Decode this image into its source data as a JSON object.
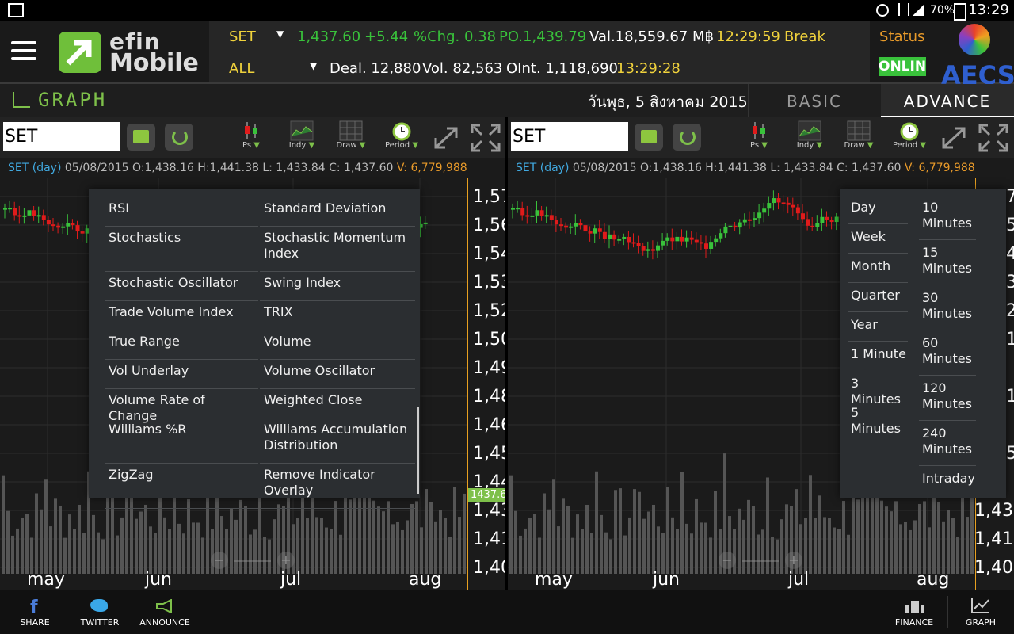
{
  "status_bar": {
    "battery": "70%",
    "time": "13:29"
  },
  "header": {
    "logo_line1": "efin",
    "logo_line2": "Mobile",
    "row1": {
      "symbol": "SET",
      "last": "1,437.60",
      "change": "+5.44",
      "pct_change": "%Chg. 0.38",
      "po": "PO.1,439.79",
      "value": "Val.18,559.67 M฿",
      "time": "12:29:59",
      "session": "Break"
    },
    "row2": {
      "market": "ALL",
      "deal": "Deal. 12,880",
      "volume": "Vol. 82,563",
      "open_interest": "OInt. 1,118,690",
      "time": "13:29:28"
    },
    "status_label": "Status",
    "status_value": "ONLIN",
    "broker": "AECS"
  },
  "graph_bar": {
    "title": "GRAPH",
    "date": "วันพุธ, 5 สิงหาคม 2015",
    "tab_basic": "BASIC",
    "tab_advance": "ADVANCE"
  },
  "toolbar": {
    "symbol_value": "SET",
    "tools": [
      "Ps",
      "Indy",
      "Draw",
      "Period"
    ]
  },
  "info": {
    "symbol_period": "SET (day)",
    "ohlc": "05/08/2015 O:1,438.16 H:1,441.38 L: 1,433.84 C: 1,437.60",
    "volume": "V: 6,779,988"
  },
  "axis": {
    "y_ticks": [
      "1,57",
      "1,56",
      "1,54",
      "1,53",
      "1,52",
      "1,50",
      "1,49",
      "1,48",
      "1,46",
      "1,45",
      "1,44",
      "1,43",
      "1,41",
      "1,40"
    ],
    "current_price": "1437.6",
    "months": [
      "may",
      "jun",
      "jul",
      "aug"
    ]
  },
  "right_axis_partial": [
    "7",
    "5",
    "4",
    "3",
    "2",
    "1",
    "1",
    "5",
    "1,43",
    "1,41",
    "1,40"
  ],
  "indicator_menu": [
    [
      "RSI",
      "Standard Deviation"
    ],
    [
      "Stochastics",
      "Stochastic Momentum Index"
    ],
    [
      "Stochastic Oscillator",
      "Swing Index"
    ],
    [
      "Trade Volume Index",
      "TRIX"
    ],
    [
      "True Range",
      "Volume"
    ],
    [
      "Vol Underlay",
      "Volume Oscillator"
    ],
    [
      "Volume Rate of Change",
      "Weighted Close"
    ],
    [
      "Williams %R",
      "Williams Accumulation Distribution"
    ],
    [
      "ZigZag",
      "Remove Indicator Overlay"
    ]
  ],
  "period_menu": {
    "left": [
      "Day",
      "Week",
      "Month",
      "Quarter",
      "Year",
      "1 Minute",
      "3 Minutes",
      "5 Minutes"
    ],
    "right": [
      "10 Minutes",
      "15 Minutes",
      "30 Minutes",
      "60 Minutes",
      "120 Minutes",
      "240 Minutes",
      "Intraday"
    ]
  },
  "bottom_nav": {
    "share": "SHARE",
    "twitter": "TWITTER",
    "announce": "ANNOUNCE",
    "finance": "FINANCE",
    "graph": "GRAPH"
  },
  "colors": {
    "up": "#39c23b",
    "down": "#e01b1b",
    "accent": "#7ec04a",
    "price": "#f0d23c"
  }
}
